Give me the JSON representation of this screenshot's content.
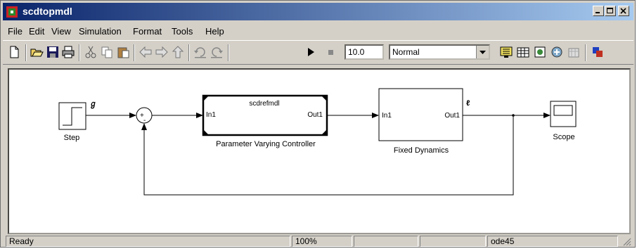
{
  "window": {
    "title": "scdtopmdl"
  },
  "menu": [
    "File",
    "Edit",
    "View",
    "Simulation",
    "Format",
    "Tools",
    "Help"
  ],
  "toolbar": {
    "stop_time": "10.0",
    "sim_mode": "Normal",
    "icons": [
      "new-icon",
      "open-icon",
      "save-icon",
      "print-icon",
      "cut-icon",
      "copy-icon",
      "paste-icon",
      "back-icon",
      "forward-icon",
      "up-icon",
      "undo-icon",
      "redo-icon",
      "play-icon",
      "stop-icon",
      "build-icon",
      "library-icon",
      "model-explorer-icon",
      "debug-icon",
      "update-icon",
      "record-icon"
    ]
  },
  "diagram": {
    "step_label": "Step",
    "controller_title": "scdrefmdl",
    "controller_in": "In1",
    "controller_out": "Out1",
    "controller_label": "Parameter Varying Controller",
    "plant_in": "In1",
    "plant_out": "Out1",
    "plant_label": "Fixed Dynamics",
    "scope_label": "Scope",
    "sum_plus": "+",
    "sum_minus": "-"
  },
  "status": {
    "state": "Ready",
    "zoom": "100%",
    "solver": "ode45"
  },
  "colors": {
    "titlebar_start": "#0a246a",
    "titlebar_end": "#a6caf0",
    "chrome": "#d4d0c8"
  }
}
